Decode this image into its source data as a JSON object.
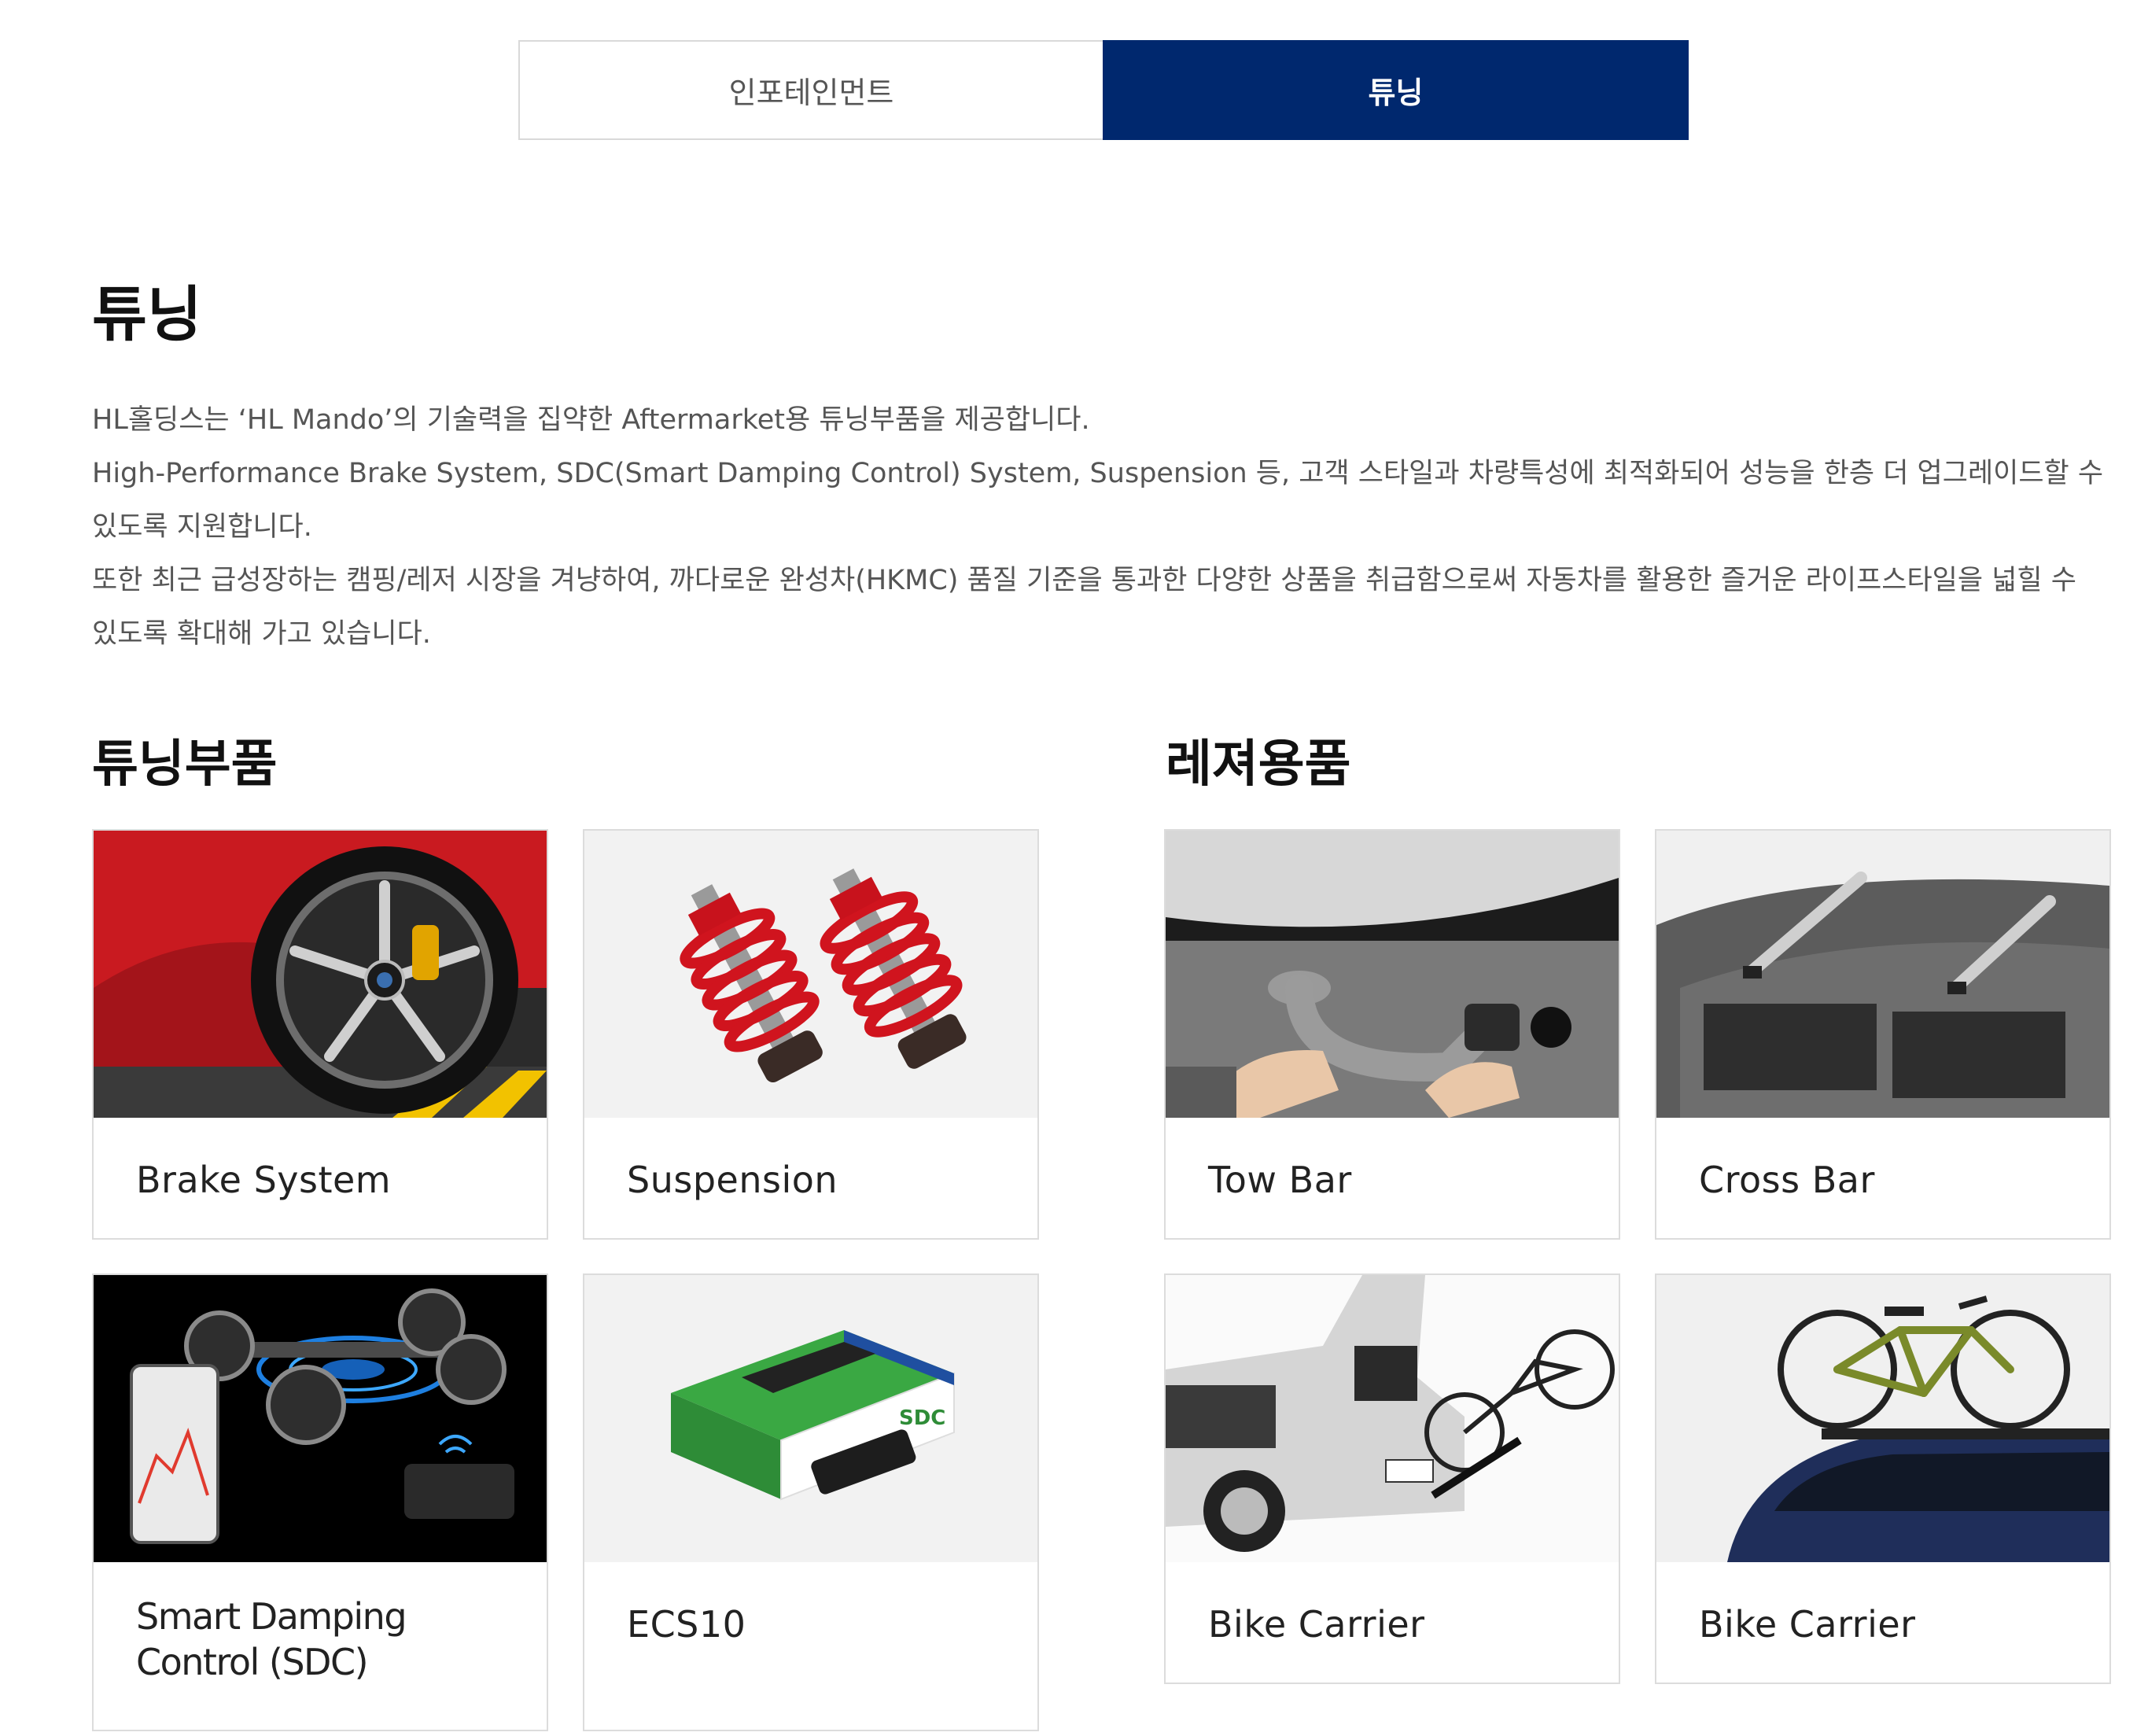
{
  "tabs": [
    {
      "label": "인포테인먼트",
      "active": false
    },
    {
      "label": "튜닝",
      "active": true
    }
  ],
  "page": {
    "title": "튜닝",
    "intro": [
      "HL홀딩스는 ‘HL Mando’의 기술력을 집약한 Aftermarket용 튜닝부품을 제공합니다.",
      "High-Performance Brake System, SDC(Smart Damping Control) System, Suspension 등, 고객 스타일과 차량특성에 최적화되어 성능을 한층 더 업그레이드할 수 있도록 지원합니다.",
      "또한 최근 급성장하는 캠핑/레저 시장을 겨냥하여, 까다로운 완성차(HKMC) 품질 기준을 통과한 다양한 상품을 취급함으로써 자동차를 활용한 즐거운 라이프스타일을 넓힐 수 있도록 확대해 가고 있습니다."
    ]
  },
  "sections": {
    "tuning": {
      "title": "튜닝부품",
      "items": [
        {
          "label": "Brake System",
          "icon": "brake-wheel-photo"
        },
        {
          "label": "Suspension",
          "icon": "coilover-photo"
        },
        {
          "label": "Smart Damping Control (SDC)",
          "icon": "sdc-chassis-photo"
        },
        {
          "label": "ECS10",
          "icon": "ecs10-box-photo"
        }
      ]
    },
    "leisure": {
      "title": "레져용품",
      "items": [
        {
          "label": "Tow Bar",
          "icon": "tow-bar-photo"
        },
        {
          "label": "Cross Bar",
          "icon": "cross-bar-photo"
        },
        {
          "label": "Bike Carrier",
          "icon": "hitch-bike-carrier-photo"
        },
        {
          "label": "Bike Carrier",
          "icon": "roof-bike-carrier-photo"
        }
      ]
    }
  },
  "colors": {
    "active_tab": "#00286e",
    "card_border": "#dcdcdc",
    "body_text": "#555555"
  }
}
